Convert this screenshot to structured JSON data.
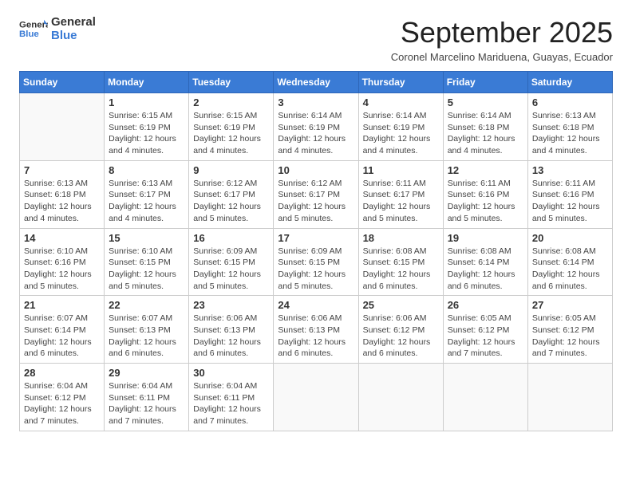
{
  "logo": {
    "general": "General",
    "blue": "Blue"
  },
  "title": "September 2025",
  "subtitle": "Coronel Marcelino Mariduena, Guayas, Ecuador",
  "headers": [
    "Sunday",
    "Monday",
    "Tuesday",
    "Wednesday",
    "Thursday",
    "Friday",
    "Saturday"
  ],
  "weeks": [
    [
      {
        "day": "",
        "info": ""
      },
      {
        "day": "1",
        "info": "Sunrise: 6:15 AM\nSunset: 6:19 PM\nDaylight: 12 hours\nand 4 minutes."
      },
      {
        "day": "2",
        "info": "Sunrise: 6:15 AM\nSunset: 6:19 PM\nDaylight: 12 hours\nand 4 minutes."
      },
      {
        "day": "3",
        "info": "Sunrise: 6:14 AM\nSunset: 6:19 PM\nDaylight: 12 hours\nand 4 minutes."
      },
      {
        "day": "4",
        "info": "Sunrise: 6:14 AM\nSunset: 6:19 PM\nDaylight: 12 hours\nand 4 minutes."
      },
      {
        "day": "5",
        "info": "Sunrise: 6:14 AM\nSunset: 6:18 PM\nDaylight: 12 hours\nand 4 minutes."
      },
      {
        "day": "6",
        "info": "Sunrise: 6:13 AM\nSunset: 6:18 PM\nDaylight: 12 hours\nand 4 minutes."
      }
    ],
    [
      {
        "day": "7",
        "info": "Sunrise: 6:13 AM\nSunset: 6:18 PM\nDaylight: 12 hours\nand 4 minutes."
      },
      {
        "day": "8",
        "info": "Sunrise: 6:13 AM\nSunset: 6:17 PM\nDaylight: 12 hours\nand 4 minutes."
      },
      {
        "day": "9",
        "info": "Sunrise: 6:12 AM\nSunset: 6:17 PM\nDaylight: 12 hours\nand 5 minutes."
      },
      {
        "day": "10",
        "info": "Sunrise: 6:12 AM\nSunset: 6:17 PM\nDaylight: 12 hours\nand 5 minutes."
      },
      {
        "day": "11",
        "info": "Sunrise: 6:11 AM\nSunset: 6:17 PM\nDaylight: 12 hours\nand 5 minutes."
      },
      {
        "day": "12",
        "info": "Sunrise: 6:11 AM\nSunset: 6:16 PM\nDaylight: 12 hours\nand 5 minutes."
      },
      {
        "day": "13",
        "info": "Sunrise: 6:11 AM\nSunset: 6:16 PM\nDaylight: 12 hours\nand 5 minutes."
      }
    ],
    [
      {
        "day": "14",
        "info": "Sunrise: 6:10 AM\nSunset: 6:16 PM\nDaylight: 12 hours\nand 5 minutes."
      },
      {
        "day": "15",
        "info": "Sunrise: 6:10 AM\nSunset: 6:15 PM\nDaylight: 12 hours\nand 5 minutes."
      },
      {
        "day": "16",
        "info": "Sunrise: 6:09 AM\nSunset: 6:15 PM\nDaylight: 12 hours\nand 5 minutes."
      },
      {
        "day": "17",
        "info": "Sunrise: 6:09 AM\nSunset: 6:15 PM\nDaylight: 12 hours\nand 5 minutes."
      },
      {
        "day": "18",
        "info": "Sunrise: 6:08 AM\nSunset: 6:15 PM\nDaylight: 12 hours\nand 6 minutes."
      },
      {
        "day": "19",
        "info": "Sunrise: 6:08 AM\nSunset: 6:14 PM\nDaylight: 12 hours\nand 6 minutes."
      },
      {
        "day": "20",
        "info": "Sunrise: 6:08 AM\nSunset: 6:14 PM\nDaylight: 12 hours\nand 6 minutes."
      }
    ],
    [
      {
        "day": "21",
        "info": "Sunrise: 6:07 AM\nSunset: 6:14 PM\nDaylight: 12 hours\nand 6 minutes."
      },
      {
        "day": "22",
        "info": "Sunrise: 6:07 AM\nSunset: 6:13 PM\nDaylight: 12 hours\nand 6 minutes."
      },
      {
        "day": "23",
        "info": "Sunrise: 6:06 AM\nSunset: 6:13 PM\nDaylight: 12 hours\nand 6 minutes."
      },
      {
        "day": "24",
        "info": "Sunrise: 6:06 AM\nSunset: 6:13 PM\nDaylight: 12 hours\nand 6 minutes."
      },
      {
        "day": "25",
        "info": "Sunrise: 6:06 AM\nSunset: 6:12 PM\nDaylight: 12 hours\nand 6 minutes."
      },
      {
        "day": "26",
        "info": "Sunrise: 6:05 AM\nSunset: 6:12 PM\nDaylight: 12 hours\nand 7 minutes."
      },
      {
        "day": "27",
        "info": "Sunrise: 6:05 AM\nSunset: 6:12 PM\nDaylight: 12 hours\nand 7 minutes."
      }
    ],
    [
      {
        "day": "28",
        "info": "Sunrise: 6:04 AM\nSunset: 6:12 PM\nDaylight: 12 hours\nand 7 minutes."
      },
      {
        "day": "29",
        "info": "Sunrise: 6:04 AM\nSunset: 6:11 PM\nDaylight: 12 hours\nand 7 minutes."
      },
      {
        "day": "30",
        "info": "Sunrise: 6:04 AM\nSunset: 6:11 PM\nDaylight: 12 hours\nand 7 minutes."
      },
      {
        "day": "",
        "info": ""
      },
      {
        "day": "",
        "info": ""
      },
      {
        "day": "",
        "info": ""
      },
      {
        "day": "",
        "info": ""
      }
    ]
  ]
}
